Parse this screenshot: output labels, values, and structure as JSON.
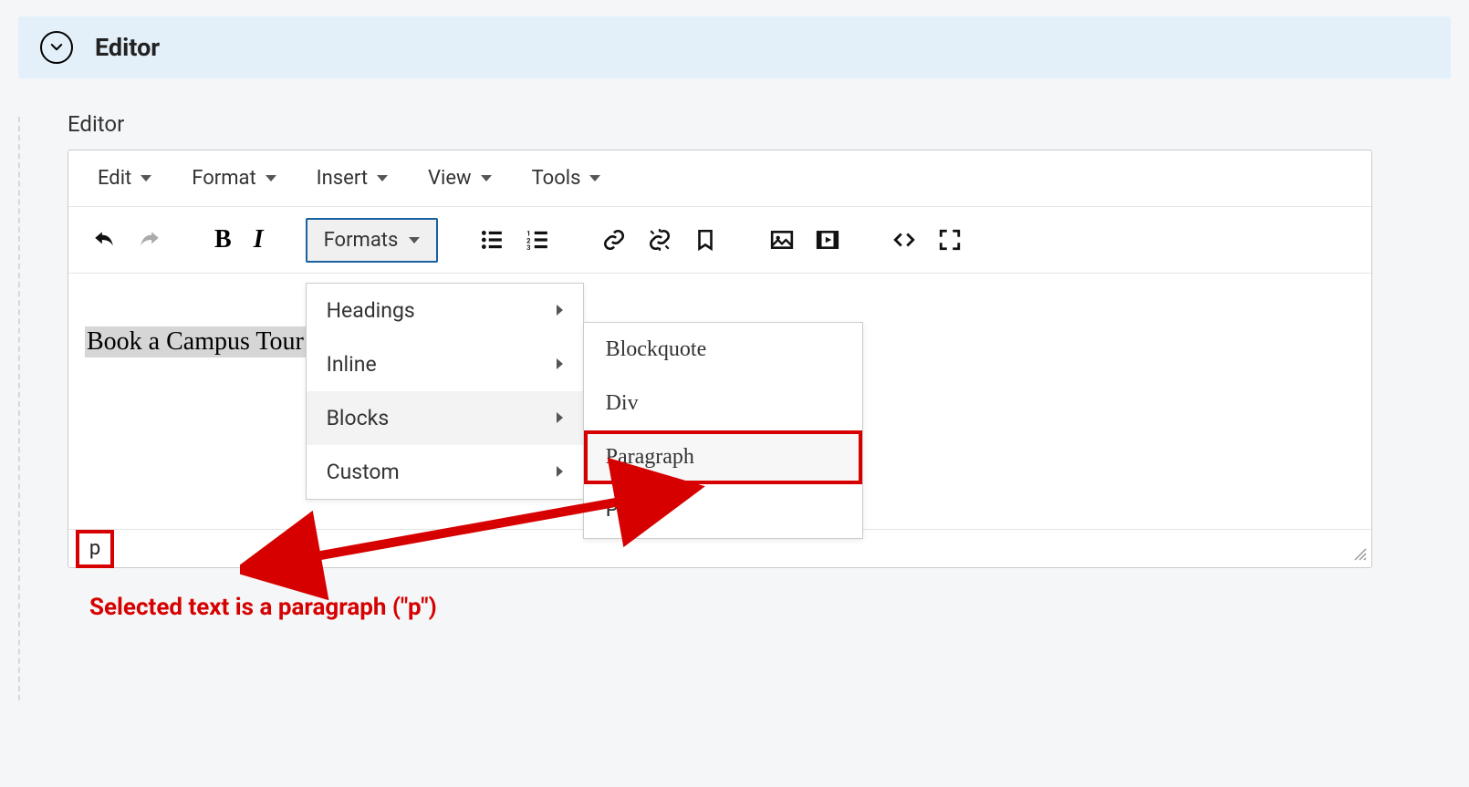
{
  "panel_title": "Editor",
  "section_label": "Editor",
  "menubar": {
    "edit": "Edit",
    "format": "Format",
    "insert": "Insert",
    "view": "View",
    "tools": "Tools"
  },
  "toolbar": {
    "formats_label": "Formats"
  },
  "content": {
    "selected_text": "Book a Campus Tour"
  },
  "formats_menu": {
    "headings": "Headings",
    "inline": "Inline",
    "blocks": "Blocks",
    "custom": "Custom"
  },
  "blocks_submenu": {
    "blockquote": "Blockquote",
    "div": "Div",
    "paragraph": "Paragraph",
    "pre": "Pre"
  },
  "status": {
    "path": "p"
  },
  "annotation": "Selected text is a paragraph (\"p\")",
  "colors": {
    "highlight_red": "#d60000",
    "panel_blue": "#e4f0f9",
    "active_border_blue": "#1861a0"
  }
}
